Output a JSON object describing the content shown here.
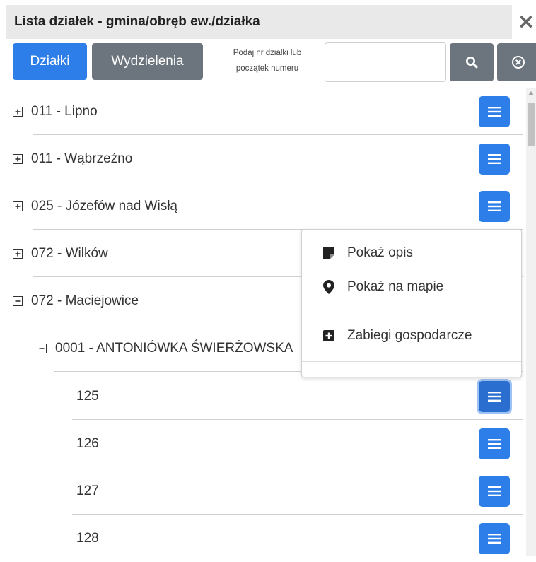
{
  "title": "Lista działek - gmina/obręb ew./działka",
  "toolbar": {
    "tab_dzialki": "Działki",
    "tab_wydzielenia": "Wydzielenia",
    "search_hint_line1": "Podaj nr działki lub",
    "search_hint_line2": "początek numeru",
    "search_value": ""
  },
  "tree": [
    {
      "label": "011 - Lipno",
      "state": "collapsed"
    },
    {
      "label": "011 - Wąbrzeźno",
      "state": "collapsed"
    },
    {
      "label": "025 - Józefów nad Wisłą",
      "state": "collapsed"
    },
    {
      "label": "072 - Wilków",
      "state": "collapsed"
    },
    {
      "label": "072 - Maciejowice",
      "state": "expanded"
    },
    {
      "label": "0001 - ANTONIÓWKA ŚWIERŻOWSKA",
      "state": "expanded"
    },
    {
      "label": "125"
    },
    {
      "label": "126"
    },
    {
      "label": "127"
    },
    {
      "label": "128"
    }
  ],
  "context_menu": {
    "show_description": "Pokaż opis",
    "show_on_map": "Pokaż na mapie",
    "forest_operations": "Zabiegi gospodarcze"
  },
  "colors": {
    "primary": "#2d7ee8",
    "secondary": "#6c757d",
    "title_bg": "#e9e9e9"
  }
}
